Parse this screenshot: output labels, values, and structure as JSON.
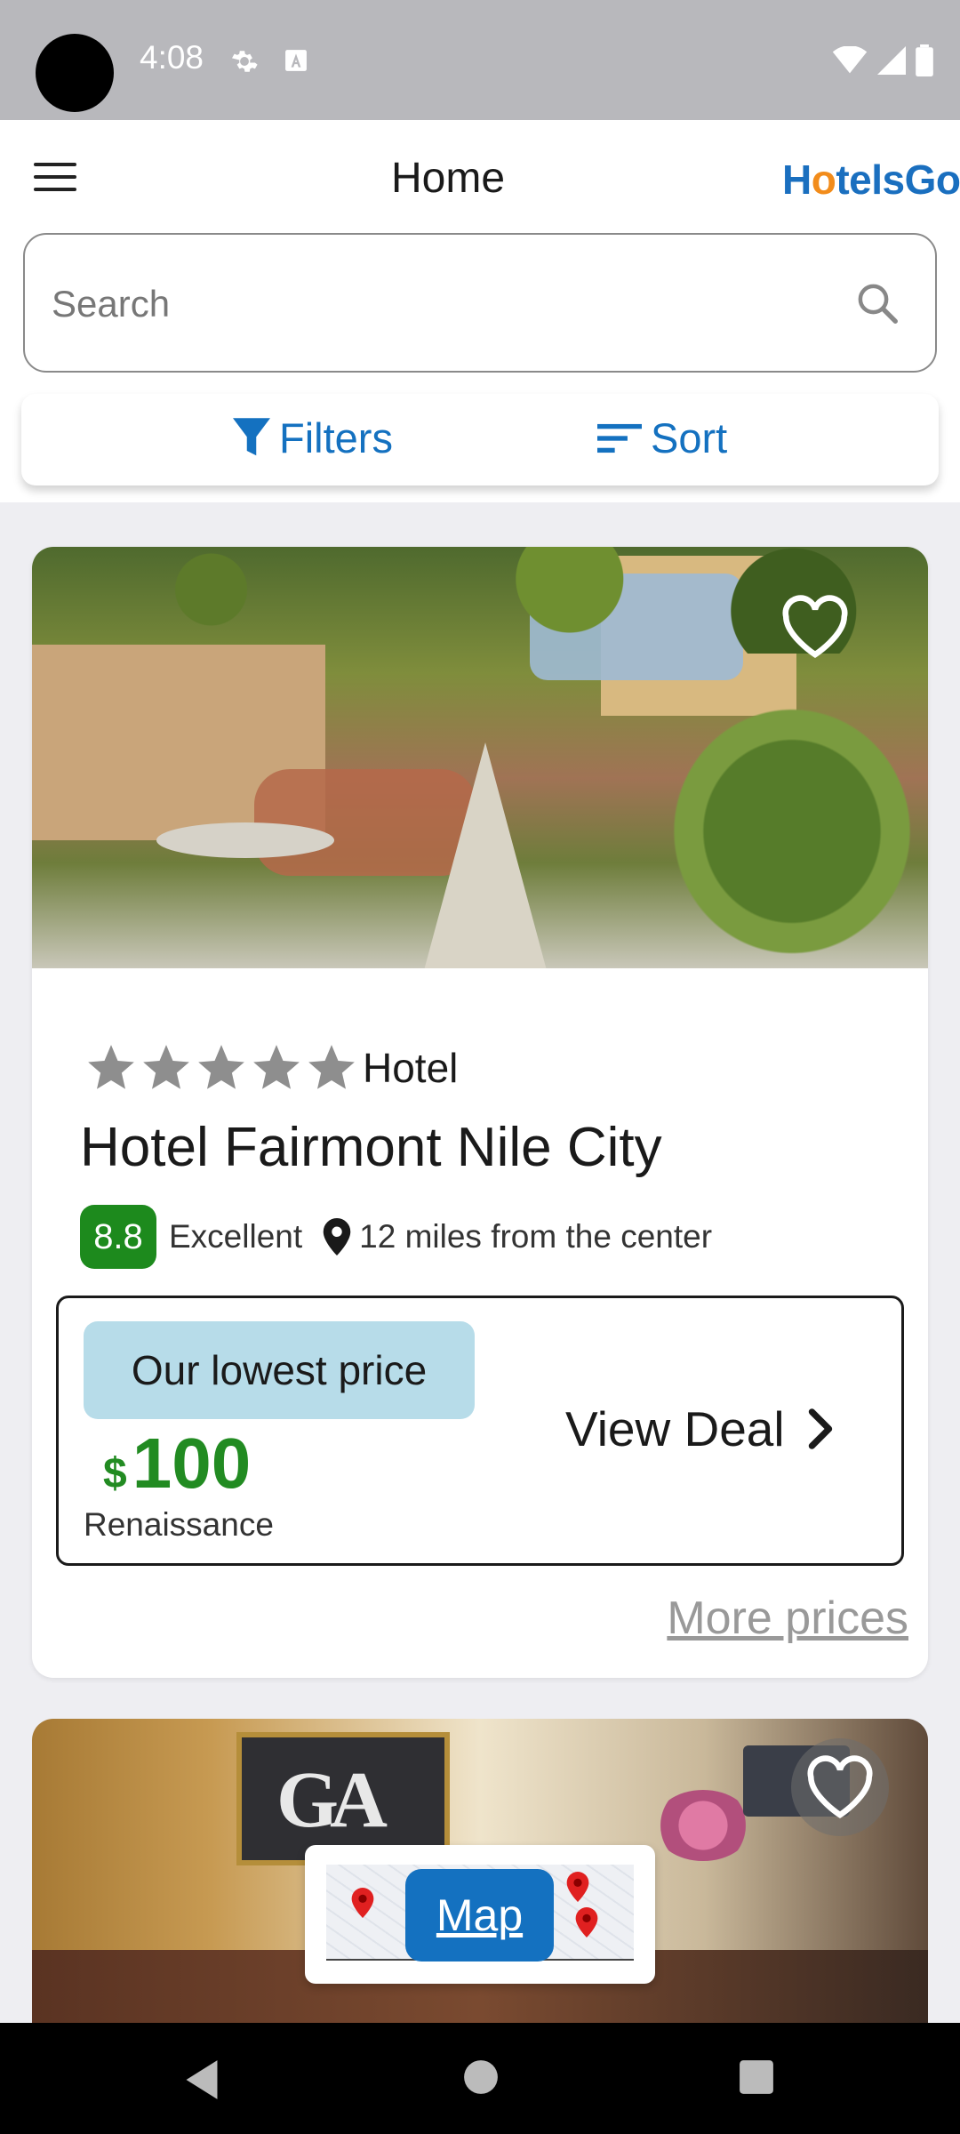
{
  "status_bar": {
    "time": "4:08"
  },
  "header": {
    "title": "Home",
    "brand_prefix": "H",
    "brand_o": "o",
    "brand_suffix": "telsGo"
  },
  "search": {
    "placeholder": "Search",
    "value": ""
  },
  "toolbar": {
    "filters_label": "Filters",
    "sort_label": "Sort"
  },
  "hotels": [
    {
      "star_rating": 5,
      "type_label": "Hotel",
      "name": "Hotel Fairmont Nile City",
      "score": "8.8",
      "score_text": "Excellent",
      "distance": "12 miles from the center",
      "price_label": "Our lowest price",
      "currency": "$",
      "price": "100",
      "provider": "Renaissance",
      "deal_label": "View Deal",
      "more_prices_label": "More prices",
      "favorite": false
    },
    {
      "sign_text": "GA",
      "favorite": false
    }
  ],
  "map_button": {
    "label": "Map"
  },
  "colors": {
    "brand_blue": "#1471c0",
    "score_green": "#1d8a1d",
    "price_green": "#228b22",
    "accent_orange": "#f28c1b",
    "label_bg": "#b7dce9"
  }
}
